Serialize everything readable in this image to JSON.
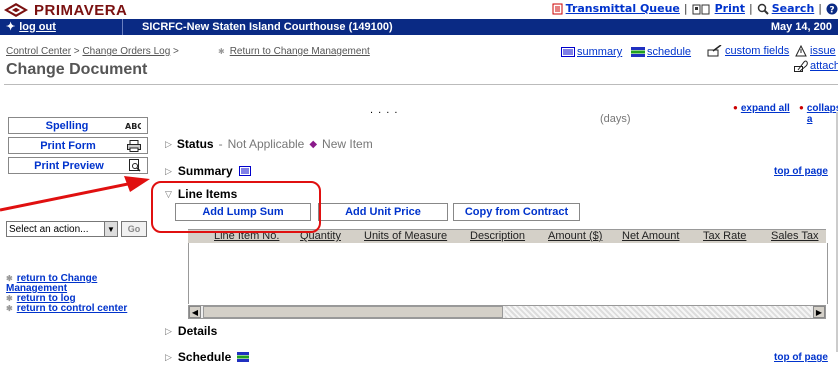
{
  "brand": {
    "name": "PRIMAVERA"
  },
  "top_links": {
    "transmittal_queue": "Transmittal Queue",
    "print": "Print",
    "search": "Search"
  },
  "bluebar": {
    "logout": "log out",
    "project": "SICRFC-New Staten Island Courthouse (149100)",
    "date": "May 14, 200"
  },
  "breadcrumb": {
    "control_center": "Control Center",
    "change_orders_log": "Change Orders Log",
    "return_link": "Return to Change Management"
  },
  "page_title": "Change Document",
  "view_links": {
    "summary": "summary",
    "schedule": "schedule",
    "custom_fields": "custom fields",
    "issues": "issue",
    "attachments": "attachment"
  },
  "sidebar": {
    "spelling": "Spelling",
    "print_form": "Print Form",
    "print_preview": "Print Preview",
    "action_select": "Select an action...",
    "go": "Go",
    "links": {
      "return_to_change_line1": "return to Change",
      "return_to_change_line2": "Management",
      "return_to_log": "return to log",
      "return_to_control_center": "return to control center"
    }
  },
  "content": {
    "dots": ". . . .",
    "days": "(days)",
    "expand_all": "expand all",
    "collapse_all": "collapse a",
    "status_label": "Status",
    "status_dash": "-",
    "status_value": "Not Applicable",
    "status_new": "New Item",
    "summary_label": "Summary",
    "top_of_page": "top of page",
    "line_items_label": "Line Items",
    "add_lump_sum": "Add Lump Sum",
    "add_unit_price": "Add Unit Price",
    "copy_from_contract": "Copy from Contract",
    "columns": [
      "Line Item No.",
      "Quantity",
      "Units of Measure",
      "Description",
      "Amount ($)",
      "Net Amount",
      "Tax Rate",
      "Sales Tax"
    ],
    "details_label": "Details",
    "schedule_label": "Schedule"
  },
  "colors": {
    "blue_bar": "#0a2a84",
    "link": "#0033cc",
    "highlight": "#e01010",
    "brand": "#7a1010"
  }
}
